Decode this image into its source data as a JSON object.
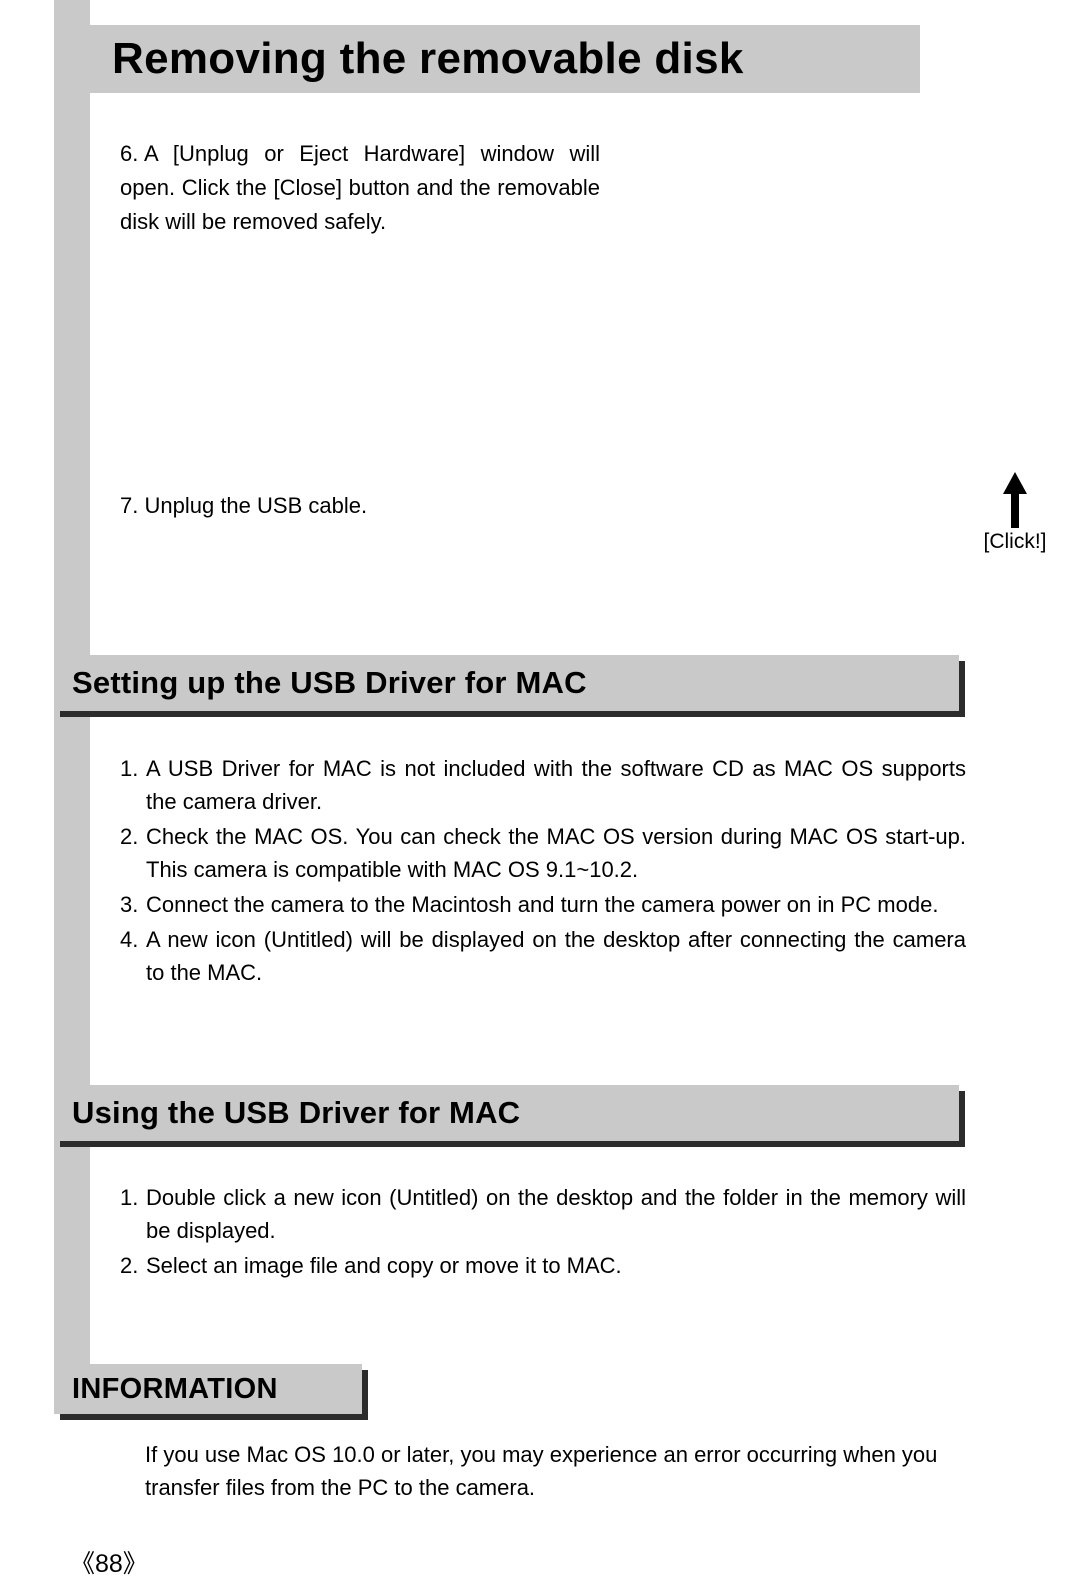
{
  "page_number_display": "《88》",
  "main_title": "Removing the removable disk",
  "steps_top": {
    "six": {
      "number": "6.",
      "text": "A [Unplug or Eject Hardware] window will open. Click the [Close] button and the removable disk will be removed safely."
    },
    "seven": {
      "number": "7.",
      "text": "Unplug the USB cable."
    }
  },
  "click_label": "[Click!]",
  "sections": {
    "setup": {
      "title": "Setting up the USB Driver for MAC",
      "items": [
        {
          "number": "1.",
          "text": "A USB Driver for MAC is not included with the software CD as MAC OS supports the camera driver."
        },
        {
          "number": "2.",
          "text": "Check the MAC OS. You can check the MAC OS version during MAC OS start-up. This camera is compatible with MAC OS 9.1~10.2."
        },
        {
          "number": "3.",
          "text": "Connect the camera to the Macintosh and turn the camera power on in PC mode."
        },
        {
          "number": "4.",
          "text": "A new icon (Untitled) will be displayed on the desktop after connecting the camera to the MAC."
        }
      ]
    },
    "using": {
      "title": "Using the USB Driver for MAC",
      "items": [
        {
          "number": "1.",
          "text": "Double click a new icon (Untitled) on the desktop and the folder in the memory will be displayed."
        },
        {
          "number": "2.",
          "text": "Select an image file and copy or move it to MAC."
        }
      ]
    }
  },
  "information": {
    "title": "INFORMATION",
    "body": "If you use Mac OS 10.0 or later, you may experience an error occurring when you transfer files from the PC to the camera."
  }
}
